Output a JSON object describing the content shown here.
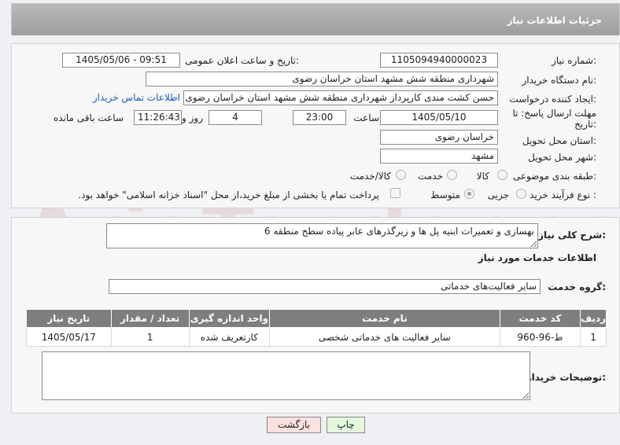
{
  "header": {
    "title": "جزئیات اطلاعات نیاز"
  },
  "form": {
    "need_number_label": "شماره نیاز:",
    "need_number": "1105094940000023",
    "announce_label": "تاریخ و ساعت اعلان عمومی:",
    "announce_value": "1405/05/06 - 09:51",
    "buyer_org_label": "نام دستگاه خریدار:",
    "buyer_org": "شهرداری منطقه شش مشهد استان خراسان رضوی",
    "creator_label": "ایجاد کننده درخواست:",
    "creator": "حسن کشت مندی کارپرداز شهرداری منطقه شش مشهد استان خراسان رضوی",
    "contact_link": "اطلاعات تماس خریدار",
    "deadline_label_1": "مهلت ارسال پاسخ: تا",
    "deadline_label_2": "تاریخ:",
    "deadline_date": "1405/05/10",
    "time_label": "ساعت",
    "deadline_time": "23:00",
    "days_value": "4",
    "days_label": "روز و",
    "remaining_time": "11:26:43",
    "remaining_label": "ساعت باقی مانده",
    "province_label": "استان محل تحویل:",
    "province": "خراسان رضوی",
    "city_label": "شهر محل تحویل:",
    "city": "مشهد",
    "category_label": "طبقه بندی موضوعی:",
    "category_options": [
      "کالا",
      "خدمت",
      "کالا/خدمت"
    ],
    "process_label": "نوع فرآیند خرید :",
    "process_options": [
      "جزیی",
      "متوسط"
    ],
    "payment_note": "پرداخت تمام یا بخشی از مبلغ خرید،از محل \"اسناد خزانه اسلامی\" خواهد بود."
  },
  "details": {
    "summary_label": "شرح کلی نیاز:",
    "summary": "بهسازی و تعمیرات ابنیه پل ها و زیرگذرهای عابر پیاده سطح منطقه 6",
    "services_heading": "اطلاعات خدمات مورد نیاز",
    "service_group_label": "گروه خدمت:",
    "service_group": "سایر فعالیت‌های خدماتی",
    "table_headers": [
      "ردیف",
      "کد خدمت",
      "نام خدمت",
      "واحد اندازه گیری",
      "تعداد / مقدار",
      "تاریخ نیاز"
    ],
    "table_rows": [
      [
        "1",
        "ط-96-960",
        "سایر فعالیت های خدماتی شخصی",
        "کارتعریف شده",
        "1",
        "1405/05/17"
      ]
    ],
    "buyer_notes_label": "توضیحات خریدار:"
  },
  "buttons": {
    "print": "چاپ",
    "back": "بازگشت"
  },
  "colors": {
    "header_bg": "#a8a8a8",
    "table_header_bg": "#7e7e7e",
    "link": "#1a5fb4",
    "back_button_bg": "#fde0e0",
    "print_button_bg": "#e3f7dc"
  }
}
